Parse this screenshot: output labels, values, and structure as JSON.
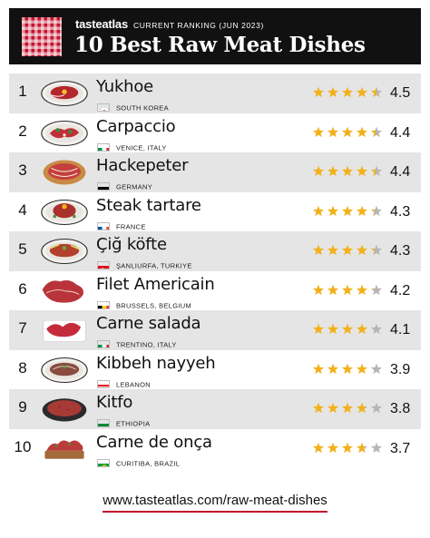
{
  "header": {
    "brand": "tasteatlas",
    "ranking": "CURRENT RANKING (JUN 2023)",
    "title": "10 Best Raw Meat Dishes"
  },
  "colors": {
    "accent": "#c4122f",
    "star": "#f2b11a",
    "star_empty": "#b5b5b5",
    "header_bg": "#111111",
    "row_shade": "#e5e5e5"
  },
  "dishes": [
    {
      "rank": "1",
      "name": "Yukhoe",
      "origin": "SOUTH KOREA",
      "flag": "south-korea-flag",
      "rating": "4.5",
      "stars": 4.5
    },
    {
      "rank": "2",
      "name": "Carpaccio",
      "origin": "VENICE, ITALY",
      "flag": "italy-flag",
      "rating": "4.4",
      "stars": 4.4
    },
    {
      "rank": "3",
      "name": "Hackepeter",
      "origin": "GERMANY",
      "flag": "germany-flag",
      "rating": "4.4",
      "stars": 4.4
    },
    {
      "rank": "4",
      "name": "Steak tartare",
      "origin": "FRANCE",
      "flag": "france-flag",
      "rating": "4.3",
      "stars": 4.3
    },
    {
      "rank": "5",
      "name": "Çiğ köfte",
      "origin": "ŞANLIURFA, TURKIYE",
      "flag": "turkey-flag",
      "rating": "4.3",
      "stars": 4.3
    },
    {
      "rank": "6",
      "name": "Filet Americain",
      "origin": "BRUSSELS, BELGIUM",
      "flag": "belgium-flag",
      "rating": "4.2",
      "stars": 4.2
    },
    {
      "rank": "7",
      "name": "Carne salada",
      "origin": "TRENTINO, ITALY",
      "flag": "italy-flag",
      "rating": "4.1",
      "stars": 4.1
    },
    {
      "rank": "8",
      "name": "Kibbeh nayyeh",
      "origin": "LEBANON",
      "flag": "lebanon-flag",
      "rating": "3.9",
      "stars": 3.9
    },
    {
      "rank": "9",
      "name": "Kitfo",
      "origin": "ETHIOPIA",
      "flag": "ethiopia-flag",
      "rating": "3.8",
      "stars": 3.8
    },
    {
      "rank": "10",
      "name": "Carne de onça",
      "origin": "CURITIBA, BRAZIL",
      "flag": "brazil-flag",
      "rating": "3.7",
      "stars": 3.7
    }
  ],
  "footer": {
    "link": "www.tasteatlas.com/raw-meat-dishes"
  }
}
